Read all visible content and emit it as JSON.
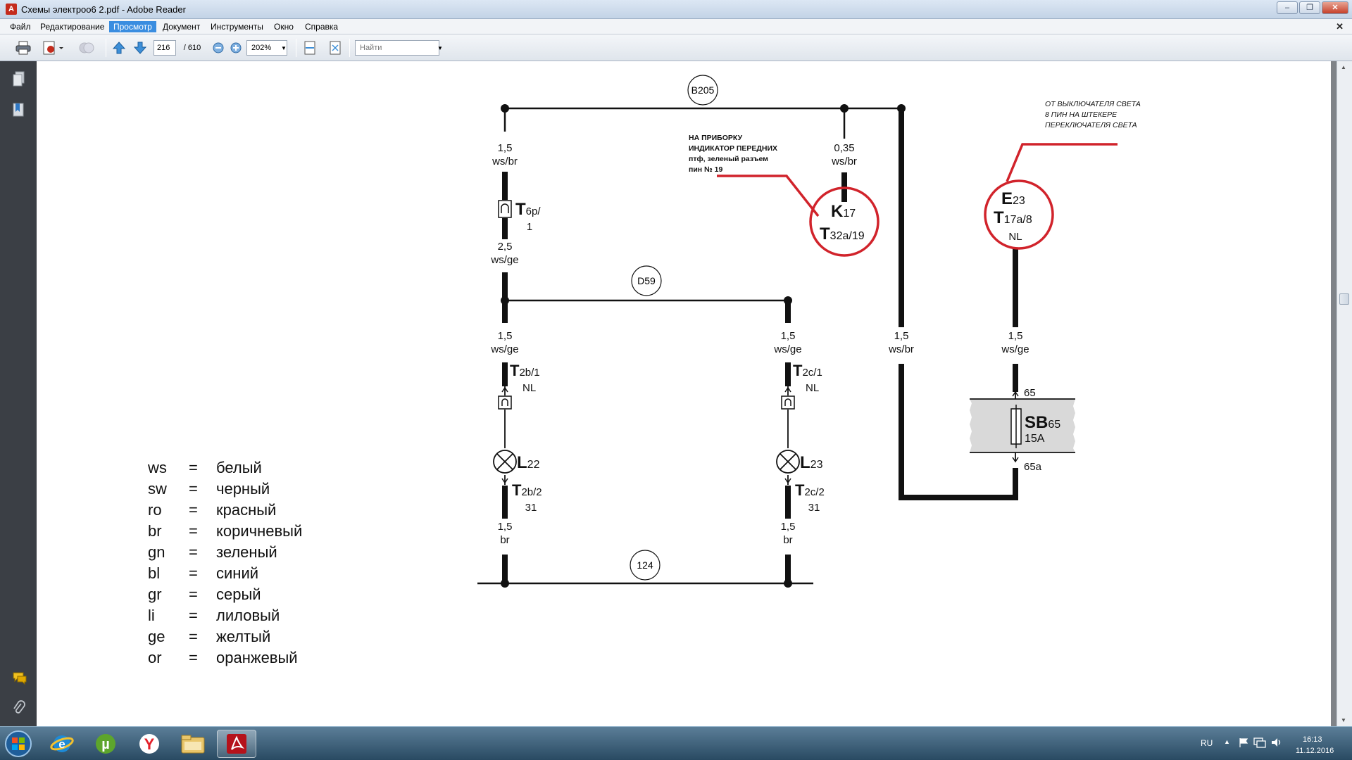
{
  "window": {
    "title": "Схемы электроо6 2.pdf - Adobe Reader"
  },
  "menu": {
    "items": [
      "Файл",
      "Редактирование",
      "Просмотр",
      "Документ",
      "Инструменты",
      "Окно",
      "Справка"
    ],
    "active": "Просмотр"
  },
  "toolbar": {
    "page_current": "216",
    "page_total": "/ 610",
    "zoom": "202%",
    "search_placeholder": "Найти"
  },
  "schematic": {
    "bus_top_label": "B205",
    "bus_mid_label": "D59",
    "bus_bottom_label": "124",
    "wire_left_top": [
      "1,5",
      "ws/br"
    ],
    "conn_t6p": {
      "main": "T",
      "sub": "6p/",
      "pin": "1"
    },
    "wire_left_mid": [
      "2,5",
      "ws/ge"
    ],
    "wire_left_low": [
      "1,5",
      "ws/ge"
    ],
    "conn_t2b1": {
      "main": "T",
      "sub": "2b/1",
      "pin": "NL"
    },
    "lamp_l22": {
      "main": "L",
      "sub": "22"
    },
    "conn_t2b2": {
      "main": "T",
      "sub": "2b/2",
      "pin": "31"
    },
    "wire_left_bottom": [
      "1,5",
      "br"
    ],
    "wire_mid_low": [
      "1,5",
      "ws/ge"
    ],
    "conn_t2c1": {
      "main": "T",
      "sub": "2c/1",
      "pin": "NL"
    },
    "lamp_l23": {
      "main": "L",
      "sub": "23"
    },
    "conn_t2c2": {
      "main": "T",
      "sub": "2c/2",
      "pin": "31"
    },
    "wire_mid_bottom": [
      "1,5",
      "br"
    ],
    "wire_k17": [
      "0,35",
      "ws/br"
    ],
    "k17": {
      "main": "K",
      "sub": "17",
      "main2": "T",
      "sub2": "32a/19"
    },
    "wire_right_bus": [
      "1,5",
      "ws/br"
    ],
    "e23": {
      "main": "E",
      "sub": "23",
      "main2": "T",
      "sub2": "17a/8",
      "pin": "NL"
    },
    "wire_e23": [
      "1,5",
      "ws/ge"
    ],
    "sb65": {
      "main": "SB",
      "sub": "65",
      "rating": "15A",
      "pin_in": "65",
      "pin_out": "65a"
    },
    "note_k17": [
      "НА ПРИБОРКУ",
      "ИНДИКАТОР ПЕРЕДНИХ",
      "птф, зеленый разъем",
      "пин № 19"
    ],
    "note_e23": [
      "ОТ ВЫКЛЮЧАТЕЛЯ СВЕТА",
      "8 ПИН НА ШТЕКЕРЕ",
      "ПЕРЕКЛЮЧАТЕЛЯ СВЕТА"
    ]
  },
  "legend": [
    {
      "code": "ws",
      "eq": "=",
      "name": "белый"
    },
    {
      "code": "sw",
      "eq": "=",
      "name": "черный"
    },
    {
      "code": "ro",
      "eq": "=",
      "name": "красный"
    },
    {
      "code": "br",
      "eq": "=",
      "name": "коричневый"
    },
    {
      "code": "gn",
      "eq": "=",
      "name": "зеленый"
    },
    {
      "code": "bl",
      "eq": "=",
      "name": "синий"
    },
    {
      "code": "gr",
      "eq": "=",
      "name": "серый"
    },
    {
      "code": "li",
      "eq": "=",
      "name": "лиловый"
    },
    {
      "code": "ge",
      "eq": "=",
      "name": "желтый"
    },
    {
      "code": "or",
      "eq": "=",
      "name": "оранжевый"
    }
  ],
  "taskbar": {
    "lang": "RU",
    "time": "16:13",
    "date": "11.12.2016"
  },
  "colors": {
    "annotation_red": "#d1232b",
    "menu_active": "#3a8de0"
  }
}
